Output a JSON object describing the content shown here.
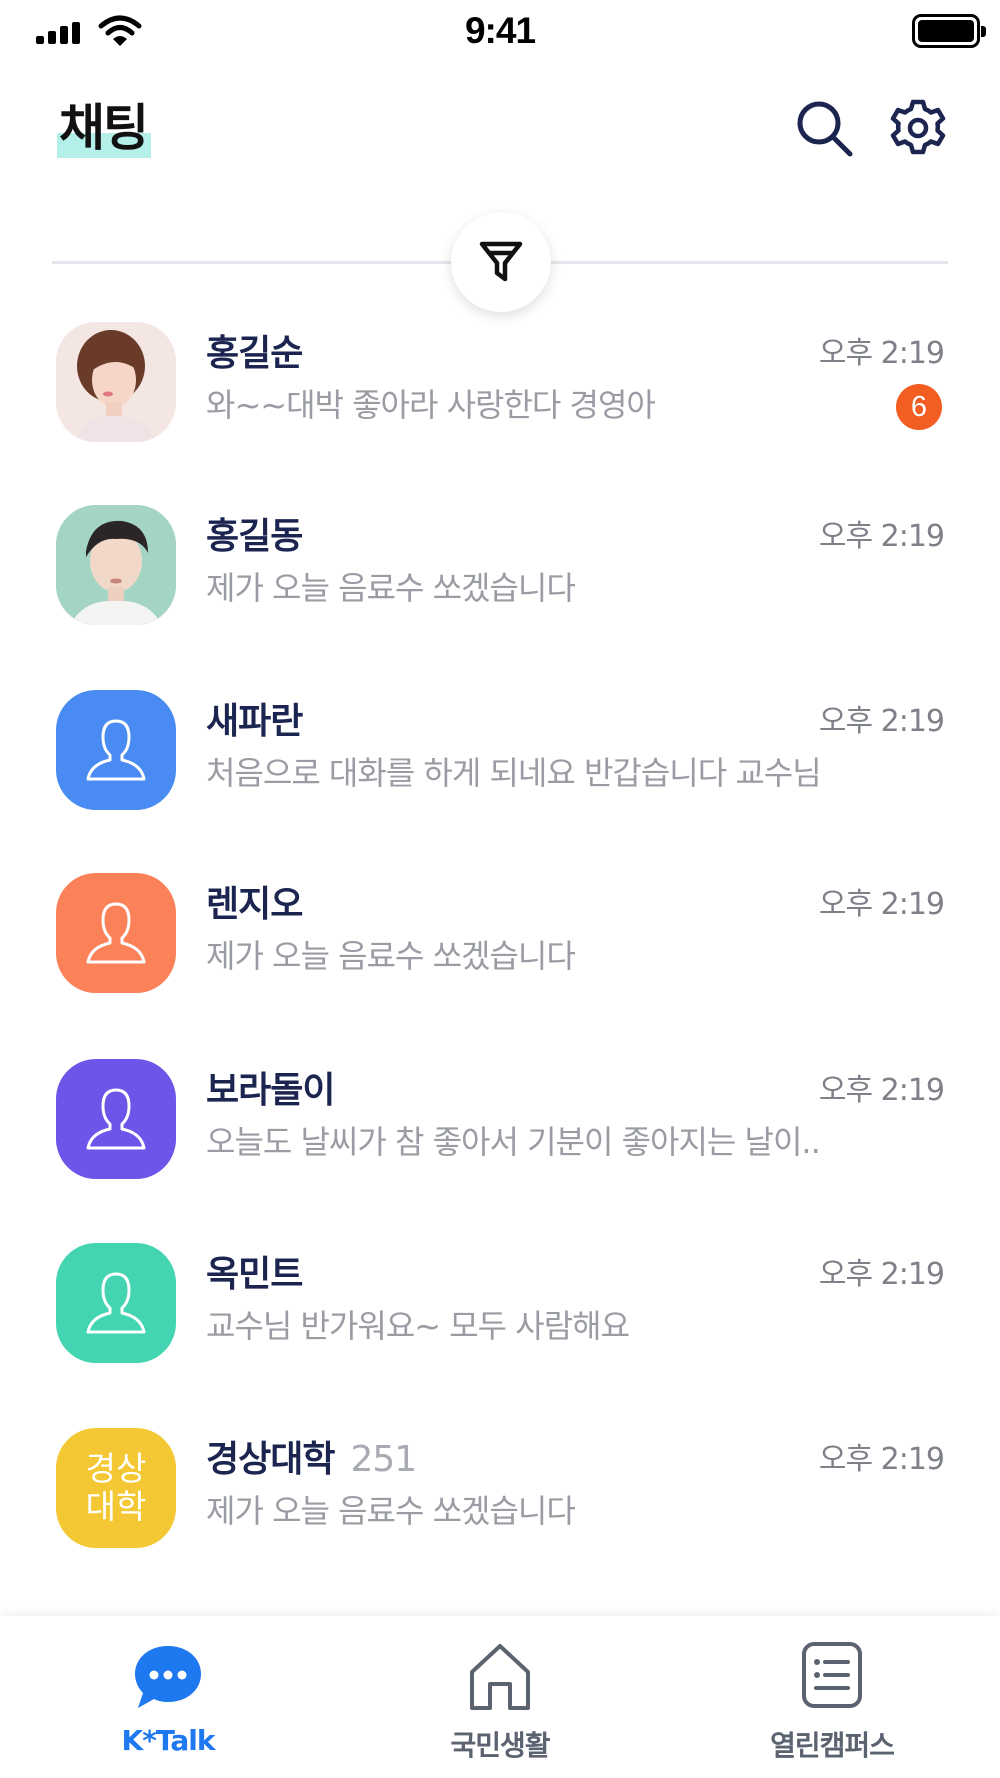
{
  "status_bar": {
    "time": "9:41"
  },
  "header": {
    "title": "채팅",
    "search_icon": "search-icon",
    "settings_icon": "gear-icon",
    "highlight_color": "#b4efe9"
  },
  "filter": {
    "icon": "filter-icon"
  },
  "chats": [
    {
      "name": "홍길순",
      "time": "오후 2:19",
      "preview": "와~~대박 좋아라 사랑한다 경영아",
      "unread": "6",
      "avatar": "photo-woman",
      "avatar_color": "#f3e4e0"
    },
    {
      "name": "홍길동",
      "time": "오후 2:19",
      "preview": "제가 오늘 음료수 쏘겠습니다",
      "avatar": "photo-man",
      "avatar_color": "#9fd1c0"
    },
    {
      "name": "새파란",
      "time": "오후 2:19",
      "preview": "처음으로 대화를 하게 되네요 반갑습니다 교수님",
      "avatar": "person-icon",
      "avatar_color": "#4a8bf3"
    },
    {
      "name": "렌지오",
      "time": "오후 2:19",
      "preview": "제가 오늘 음료수 쏘겠습니다",
      "avatar": "person-icon",
      "avatar_color": "#fa8158"
    },
    {
      "name": "보라돌이",
      "time": "오후 2:19",
      "preview": "오늘도  날씨가 참 좋아서 기분이 좋아지는 날이..",
      "avatar": "person-icon",
      "avatar_color": "#6c55e8"
    },
    {
      "name": "옥민트",
      "time": "오후 2:19",
      "preview": "교수님 반가워요~ 모두 사람해요",
      "avatar": "person-icon",
      "avatar_color": "#43d4b1"
    },
    {
      "name": "경상대학",
      "member_count": "251",
      "time": "오후 2:19",
      "preview": "제가 오늘 음료수 쏘겠습니다",
      "avatar": "text",
      "avatar_text_line1": "경상",
      "avatar_text_line2": "대학",
      "avatar_color": "#f4c834"
    }
  ],
  "bottom_nav": [
    {
      "label": "K*Talk",
      "icon": "chat-bubble-icon",
      "active": true
    },
    {
      "label": "국민생활",
      "icon": "home-icon",
      "active": false
    },
    {
      "label": "열린캠퍼스",
      "icon": "document-list-icon",
      "active": false
    }
  ],
  "colors": {
    "accent": "#1e78f0",
    "badge": "#f25d22",
    "name": "#1b2550",
    "preview": "#9a9ca3"
  }
}
